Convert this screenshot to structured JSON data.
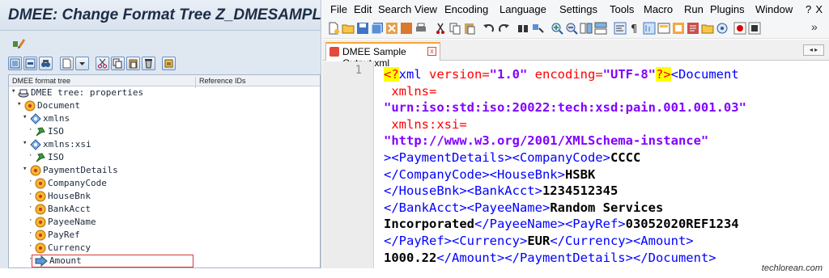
{
  "sap": {
    "title": "DMEE: Change Format Tree Z_DMESAMPLE_XML",
    "tree_headers": {
      "col1": "DMEE format tree",
      "col2": "Reference IDs"
    },
    "tree": [
      {
        "label": "DMEE tree: properties",
        "icon": "tree-root-icon",
        "level": 0
      },
      {
        "label": "Document",
        "icon": "node-icon",
        "level": 1
      },
      {
        "label": "xmlns",
        "icon": "attribute-icon",
        "level": 2
      },
      {
        "label": "ISO",
        "icon": "constant-icon",
        "level": 3
      },
      {
        "label": "xmlns:xsi",
        "icon": "attribute-icon",
        "level": 2
      },
      {
        "label": "ISO",
        "icon": "constant-icon",
        "level": 3
      },
      {
        "label": "PaymentDetails",
        "icon": "node-icon",
        "level": 2
      },
      {
        "label": "CompanyCode",
        "icon": "node-icon",
        "level": 3
      },
      {
        "label": "HouseBnk",
        "icon": "node-icon",
        "level": 3
      },
      {
        "label": "BankAcct",
        "icon": "node-icon",
        "level": 3
      },
      {
        "label": "PayeeName",
        "icon": "node-icon",
        "level": 3
      },
      {
        "label": "PayRef",
        "icon": "node-icon",
        "level": 3
      },
      {
        "label": "Currency",
        "icon": "node-icon",
        "level": 3
      },
      {
        "label": "Amount",
        "icon": "arrow-node-icon",
        "level": 3
      }
    ]
  },
  "npp": {
    "menu": [
      "File",
      "Edit",
      "Search",
      "View",
      "Encoding",
      "Language",
      "Settings",
      "Tools",
      "Macro",
      "Run",
      "Plugins",
      "Window",
      "?"
    ],
    "close_label": "X",
    "tab_name": "DMEE Sample Output.xml",
    "tab_close": "x",
    "line_number": "1",
    "overflow_label": "»",
    "code_lines": [
      [
        [
          "pi",
          "<?"
        ],
        [
          "tag",
          "xml"
        ],
        [
          "attr",
          " version="
        ],
        [
          "val",
          "\"1.0\""
        ],
        [
          "attr",
          " encoding="
        ],
        [
          "val",
          "\"UTF-8\""
        ],
        [
          "pi",
          "?>"
        ],
        [
          "tag",
          "<Document"
        ]
      ],
      [
        [
          "attr",
          " xmlns="
        ]
      ],
      [
        [
          "val",
          "\"urn:iso:std:iso:20022:tech:xsd:pain.001.001.03\""
        ]
      ],
      [
        [
          "attr",
          " xmlns:xsi="
        ]
      ],
      [
        [
          "val",
          "\"http://www.w3.org/2001/XMLSchema-instance\""
        ]
      ],
      [
        [
          "tag",
          "><PaymentDetails><CompanyCode>"
        ],
        [
          "txt",
          "CCCC"
        ]
      ],
      [
        [
          "tag",
          "</CompanyCode><HouseBnk>"
        ],
        [
          "txt",
          "HSBK"
        ]
      ],
      [
        [
          "tag",
          "</HouseBnk><BankAcct>"
        ],
        [
          "txt",
          "1234512345"
        ]
      ],
      [
        [
          "tag",
          "</BankAcct><PayeeName>"
        ],
        [
          "txt",
          "Random Services"
        ]
      ],
      [
        [
          "txt",
          "Incorporated"
        ],
        [
          "tag",
          "</PayeeName><PayRef>"
        ],
        [
          "txt",
          "03052020REF1234"
        ]
      ],
      [
        [
          "tag",
          "</PayRef><Currency>"
        ],
        [
          "txt",
          "EUR"
        ],
        [
          "tag",
          "</Currency><Amount>"
        ]
      ],
      [
        [
          "txt",
          "1000.22"
        ],
        [
          "tag",
          "</Amount></PaymentDetails></Document>"
        ]
      ]
    ]
  },
  "watermark": "techlorean.com"
}
